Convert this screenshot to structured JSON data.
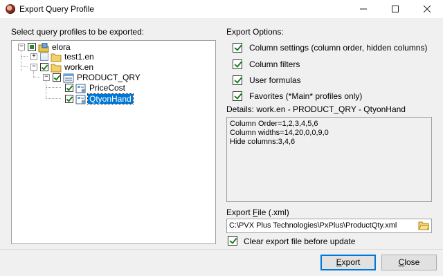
{
  "window": {
    "title": "Export Query Profile"
  },
  "left": {
    "label": "Select query profiles to be exported:",
    "tree": [
      {
        "label": "elora"
      },
      {
        "label": "test1.en"
      },
      {
        "label": "work.en"
      },
      {
        "label": "PRODUCT_QRY"
      },
      {
        "label": "PriceCost"
      },
      {
        "label": "QtyonHand"
      }
    ]
  },
  "options": {
    "label": "Export Options:",
    "items": [
      {
        "label": "Column settings (column order, hidden columns)"
      },
      {
        "label": "Column filters"
      },
      {
        "label": "User formulas"
      },
      {
        "label": "Favorites (*Main* profiles only)"
      }
    ]
  },
  "details": {
    "label": "Details: work.en - PRODUCT_QRY - QtyonHand",
    "lines": [
      "Column Order=1,2,3,4,5,6",
      "Column widths=14,20,0,0,9,0",
      "Hide columns:3,4,6"
    ]
  },
  "export_file": {
    "label_pre": "Export ",
    "label_u": "F",
    "label_post": "ile (.xml)",
    "value": "C:\\PVX Plus Technologies\\PxPlus\\ProductQty.xml"
  },
  "clear_option": {
    "label": "Clear export file before update"
  },
  "buttons": {
    "export_u": "E",
    "export_rest": "xport",
    "close_u": "C",
    "close_rest": "lose"
  },
  "colors": {
    "selection": "#0078d7",
    "check": "#1a7f1a"
  }
}
